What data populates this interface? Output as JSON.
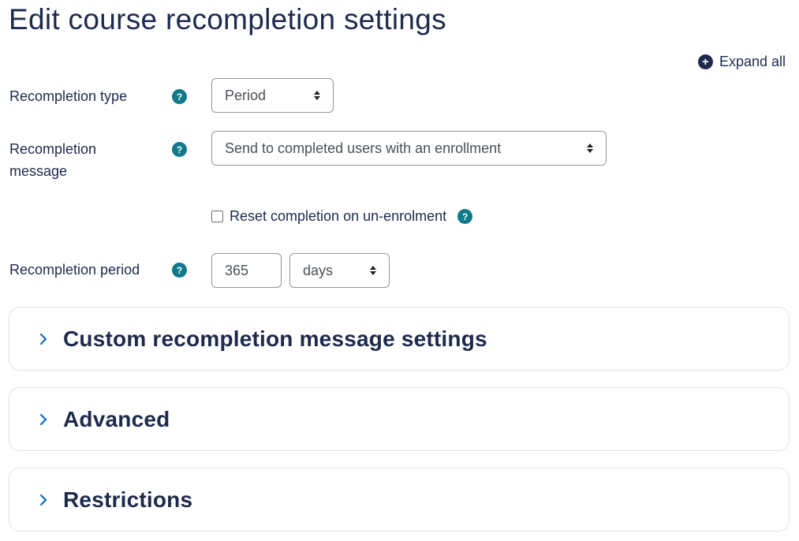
{
  "page": {
    "title": "Edit course recompletion settings",
    "expand_all_label": "Expand all",
    "expand_icon": "plus-circle-icon"
  },
  "colors": {
    "title": "#1d2a4b",
    "help_icon": "#0f7a8a",
    "chevron": "#0f6cbf",
    "border": "#8f959e"
  },
  "form": {
    "recompletion_type": {
      "label": "Recompletion type",
      "value": "Period",
      "help_icon": "question-icon"
    },
    "recompletion_message": {
      "label_line1": "Recompletion",
      "label_line2": "message",
      "value": "Send to completed users with an enrollment",
      "help_icon": "question-icon"
    },
    "reset_completion": {
      "label": "Reset completion on un-enrolment",
      "checked": false,
      "help_icon": "question-icon"
    },
    "recompletion_period": {
      "label": "Recompletion period",
      "number_value": "365",
      "unit_value": "days",
      "help_icon": "question-icon"
    }
  },
  "sections": [
    {
      "title": "Custom recompletion message settings",
      "icon": "chevron-right-icon",
      "expanded": false
    },
    {
      "title": "Advanced",
      "icon": "chevron-right-icon",
      "expanded": false
    },
    {
      "title": "Restrictions",
      "icon": "chevron-right-icon",
      "expanded": false
    }
  ]
}
